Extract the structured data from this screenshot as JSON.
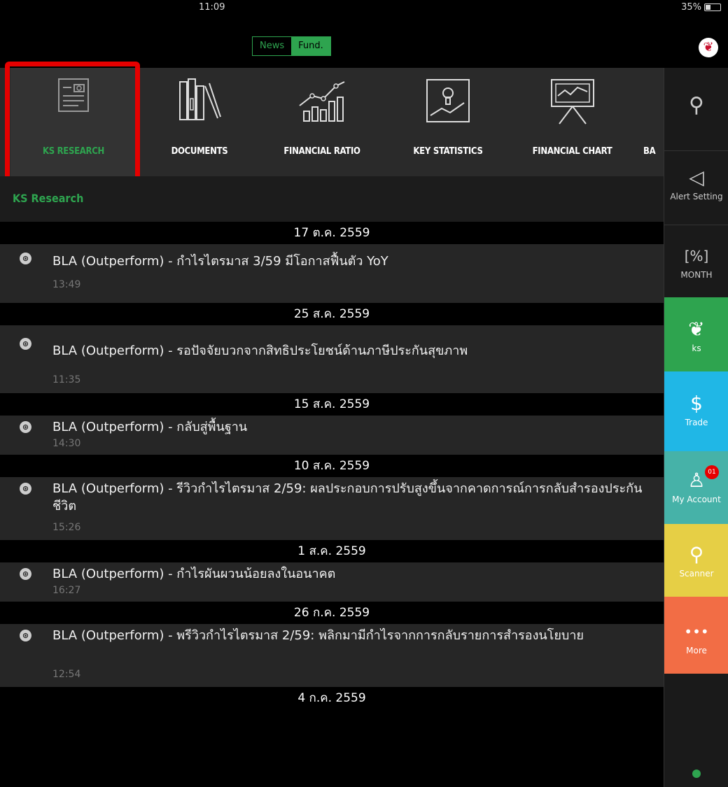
{
  "status": {
    "time": "11:09",
    "battery": "35%"
  },
  "segment": {
    "news": "News",
    "fund": "Fund."
  },
  "toolbar": {
    "items": [
      {
        "label": "KS RESEARCH",
        "icon": "research-icon"
      },
      {
        "label": "DOCUMENTS",
        "icon": "documents-icon"
      },
      {
        "label": "FINANCIAL RATIO",
        "icon": "financial-ratio-icon"
      },
      {
        "label": "KEY STATISTICS",
        "icon": "key-statistics-icon"
      },
      {
        "label": "FINANCIAL CHART",
        "icon": "financial-chart-icon"
      },
      {
        "label": "BA",
        "icon": ""
      }
    ]
  },
  "section": {
    "title": "KS Research"
  },
  "news": [
    {
      "date": "17 ต.ค. 2559",
      "title": "BLA (Outperform) - กำไรไตรมาส 3/59 มีโอกาสฟื้นตัว YoY",
      "time": "13:49"
    },
    {
      "date": "25 ส.ค. 2559",
      "title": "BLA (Outperform) - รอปัจจัยบวกจากสิทธิประโยชน์ด้านภาษีประกันสุขภาพ",
      "time": "11:35"
    },
    {
      "date": "15 ส.ค. 2559",
      "title": "BLA (Outperform) - กลับสู่พื้นฐาน",
      "time": "14:30"
    },
    {
      "date": "10 ส.ค. 2559",
      "title": "BLA (Outperform) - รีวิวกำไรไตรมาส 2/59: ผลประกอบการปรับสูงขึ้นจากคาดการณ์การกลับสำรองประกันชีวิต",
      "time": "15:26"
    },
    {
      "date": "1 ส.ค. 2559",
      "title": "BLA (Outperform) - กำไรผันผวนน้อยลงในอนาคต",
      "time": "16:27"
    },
    {
      "date": "26 ก.ค. 2559",
      "title": "BLA (Outperform) - พรีวิวกำไรไตรมาส 2/59: พลิกมามีกำไรจากการกลับรายการสำรองนโยบาย",
      "time": "12:54"
    },
    {
      "date": "4 ก.ค. 2559",
      "title": "",
      "time": ""
    }
  ],
  "sidebar": {
    "alert": "Alert Setting",
    "month": "MONTH",
    "ks": "ks",
    "trade": "Trade",
    "account": "My Account",
    "account_badge": "01",
    "scanner": "Scanner",
    "more": "More"
  },
  "colors": {
    "accent": "#2ea44f",
    "highlight": "#e60000"
  }
}
